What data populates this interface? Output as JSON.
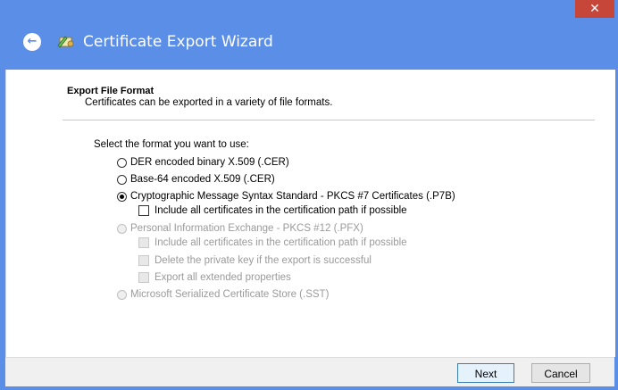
{
  "window": {
    "title": "Certificate Export Wizard",
    "close_glyph": "✕",
    "back_glyph": "←",
    "accent_color": "#5b8ee6",
    "close_color": "#c7463a"
  },
  "page": {
    "heading": "Export File Format",
    "subheading": "Certificates can be exported in a variety of file formats.",
    "prompt": "Select the format you want to use:"
  },
  "options": {
    "der": {
      "label": "DER encoded binary X.509 (.CER)",
      "selected": false,
      "enabled": true
    },
    "base64": {
      "label": "Base-64 encoded X.509 (.CER)",
      "selected": false,
      "enabled": true
    },
    "pkcs7": {
      "label": "Cryptographic Message Syntax Standard - PKCS #7 Certificates (.P7B)",
      "selected": true,
      "enabled": true
    },
    "pkcs7_include": {
      "label": "Include all certificates in the certification path if possible",
      "checked": false,
      "enabled": true
    },
    "pfx": {
      "label": "Personal Information Exchange - PKCS #12 (.PFX)",
      "selected": false,
      "enabled": false
    },
    "pfx_include": {
      "label": "Include all certificates in the certification path if possible",
      "checked": false,
      "enabled": false
    },
    "pfx_delete_key": {
      "label": "Delete the private key if the export is successful",
      "checked": false,
      "enabled": false
    },
    "pfx_export_props": {
      "label": "Export all extended properties",
      "checked": false,
      "enabled": false
    },
    "sst": {
      "label": "Microsoft Serialized Certificate Store (.SST)",
      "selected": false,
      "enabled": false
    }
  },
  "buttons": {
    "next": "Next",
    "cancel": "Cancel"
  }
}
